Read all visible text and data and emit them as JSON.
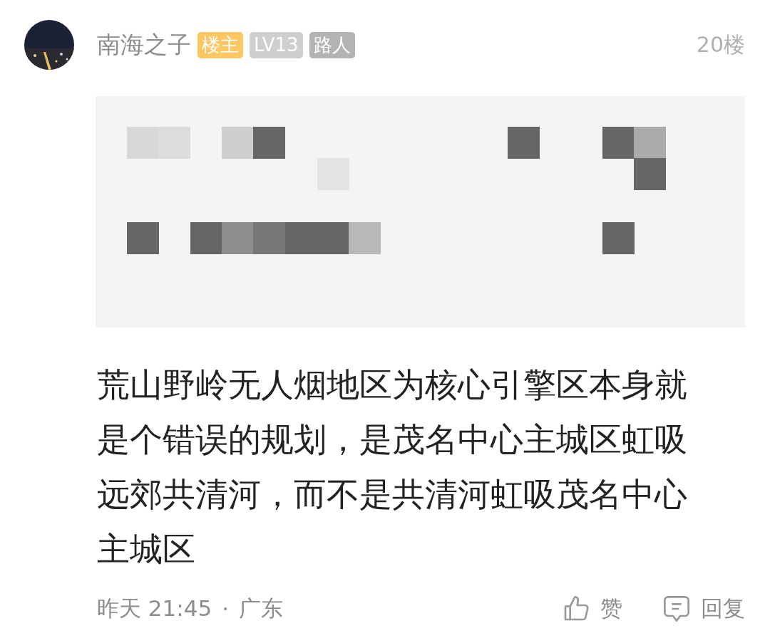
{
  "post": {
    "author": "南海之子",
    "badges": [
      {
        "label": "楼主",
        "color": "#fcc662"
      },
      {
        "label": "LV13",
        "color": "#cfcfcf"
      },
      {
        "label": "路人",
        "color": "#b3b3b3"
      }
    ],
    "floor": "20楼",
    "text": "荒山野岭无人烟地区为核心引擎区本身就是个错误的规划，是茂名中心主城区虹吸远郊共清河，而不是共清河虹吸茂名中心主城区",
    "time": "昨天 21:45",
    "separator": "·",
    "location": "广东",
    "actions": [
      {
        "kind": "like",
        "label": "赞"
      },
      {
        "kind": "reply",
        "label": "回复"
      }
    ]
  }
}
